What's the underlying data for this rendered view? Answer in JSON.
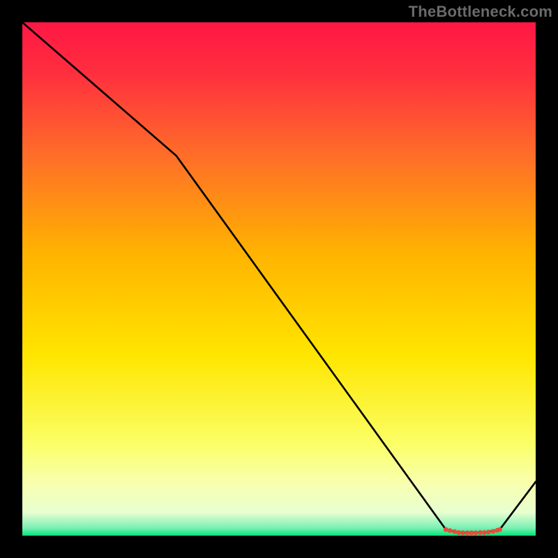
{
  "watermark": "TheBottleneck.com",
  "chart_data": {
    "type": "line",
    "title": "",
    "xlabel": "",
    "ylabel": "",
    "xlim": [
      0,
      100
    ],
    "ylim": [
      0,
      100
    ],
    "grid": false,
    "legend": false,
    "gradient_stops": [
      {
        "offset": 0.0,
        "color": "#ff1744"
      },
      {
        "offset": 0.1,
        "color": "#ff2f3e"
      },
      {
        "offset": 0.25,
        "color": "#ff6a2a"
      },
      {
        "offset": 0.45,
        "color": "#ffb300"
      },
      {
        "offset": 0.65,
        "color": "#ffe600"
      },
      {
        "offset": 0.82,
        "color": "#fbff66"
      },
      {
        "offset": 0.9,
        "color": "#f7ffb0"
      },
      {
        "offset": 0.955,
        "color": "#e8ffd0"
      },
      {
        "offset": 0.985,
        "color": "#7af0b4"
      },
      {
        "offset": 1.0,
        "color": "#00e676"
      }
    ],
    "series": [
      {
        "name": "bottleneck-curve",
        "color": "#000000",
        "x": [
          0,
          30,
          82.5,
          85,
          90,
          93,
          100
        ],
        "y": [
          100,
          74,
          1.2,
          0.6,
          0.6,
          1.2,
          10.5
        ]
      }
    ],
    "markers": {
      "name": "low-region",
      "color": "#e74c3c",
      "x": [
        82.5,
        83.3,
        84.2,
        85.0,
        85.8,
        86.7,
        87.5,
        88.3,
        89.2,
        90.0,
        90.8,
        91.7,
        92.5,
        93.0
      ],
      "y": [
        1.2,
        1.0,
        0.8,
        0.6,
        0.55,
        0.55,
        0.55,
        0.55,
        0.6,
        0.6,
        0.7,
        0.85,
        1.05,
        1.2
      ]
    }
  }
}
